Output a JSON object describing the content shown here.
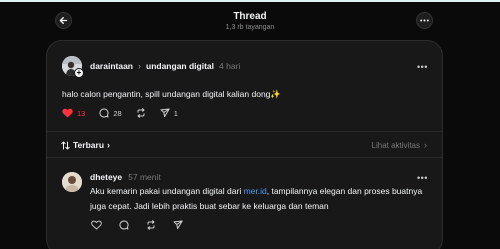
{
  "header": {
    "title": "Thread",
    "subtitle": "1,3 rb tayangan"
  },
  "post": {
    "username": "daraintaan",
    "separator_icon": "chevron-right-icon",
    "reply_target": "undangan digital",
    "time": "4 hari",
    "text": "halo calon pengantin, spill undangan digital kalian dong✨",
    "likes": "13",
    "comments": "28",
    "shares": "1",
    "like_color": "#ff3040"
  },
  "sort": {
    "label": "Terbaru",
    "activity_label": "Lihat aktivitas"
  },
  "reply": {
    "username": "dheteye",
    "time": "57 menit",
    "text_before": "Aku kemarin pakai undangan digital dari ",
    "link": "mer.id",
    "text_after": ", tampilannya elegan dan proses buatnya juga cepat. Jadi lebih praktis buat sebar ke keluarga dan teman",
    "link_color": "#4c9aff"
  }
}
